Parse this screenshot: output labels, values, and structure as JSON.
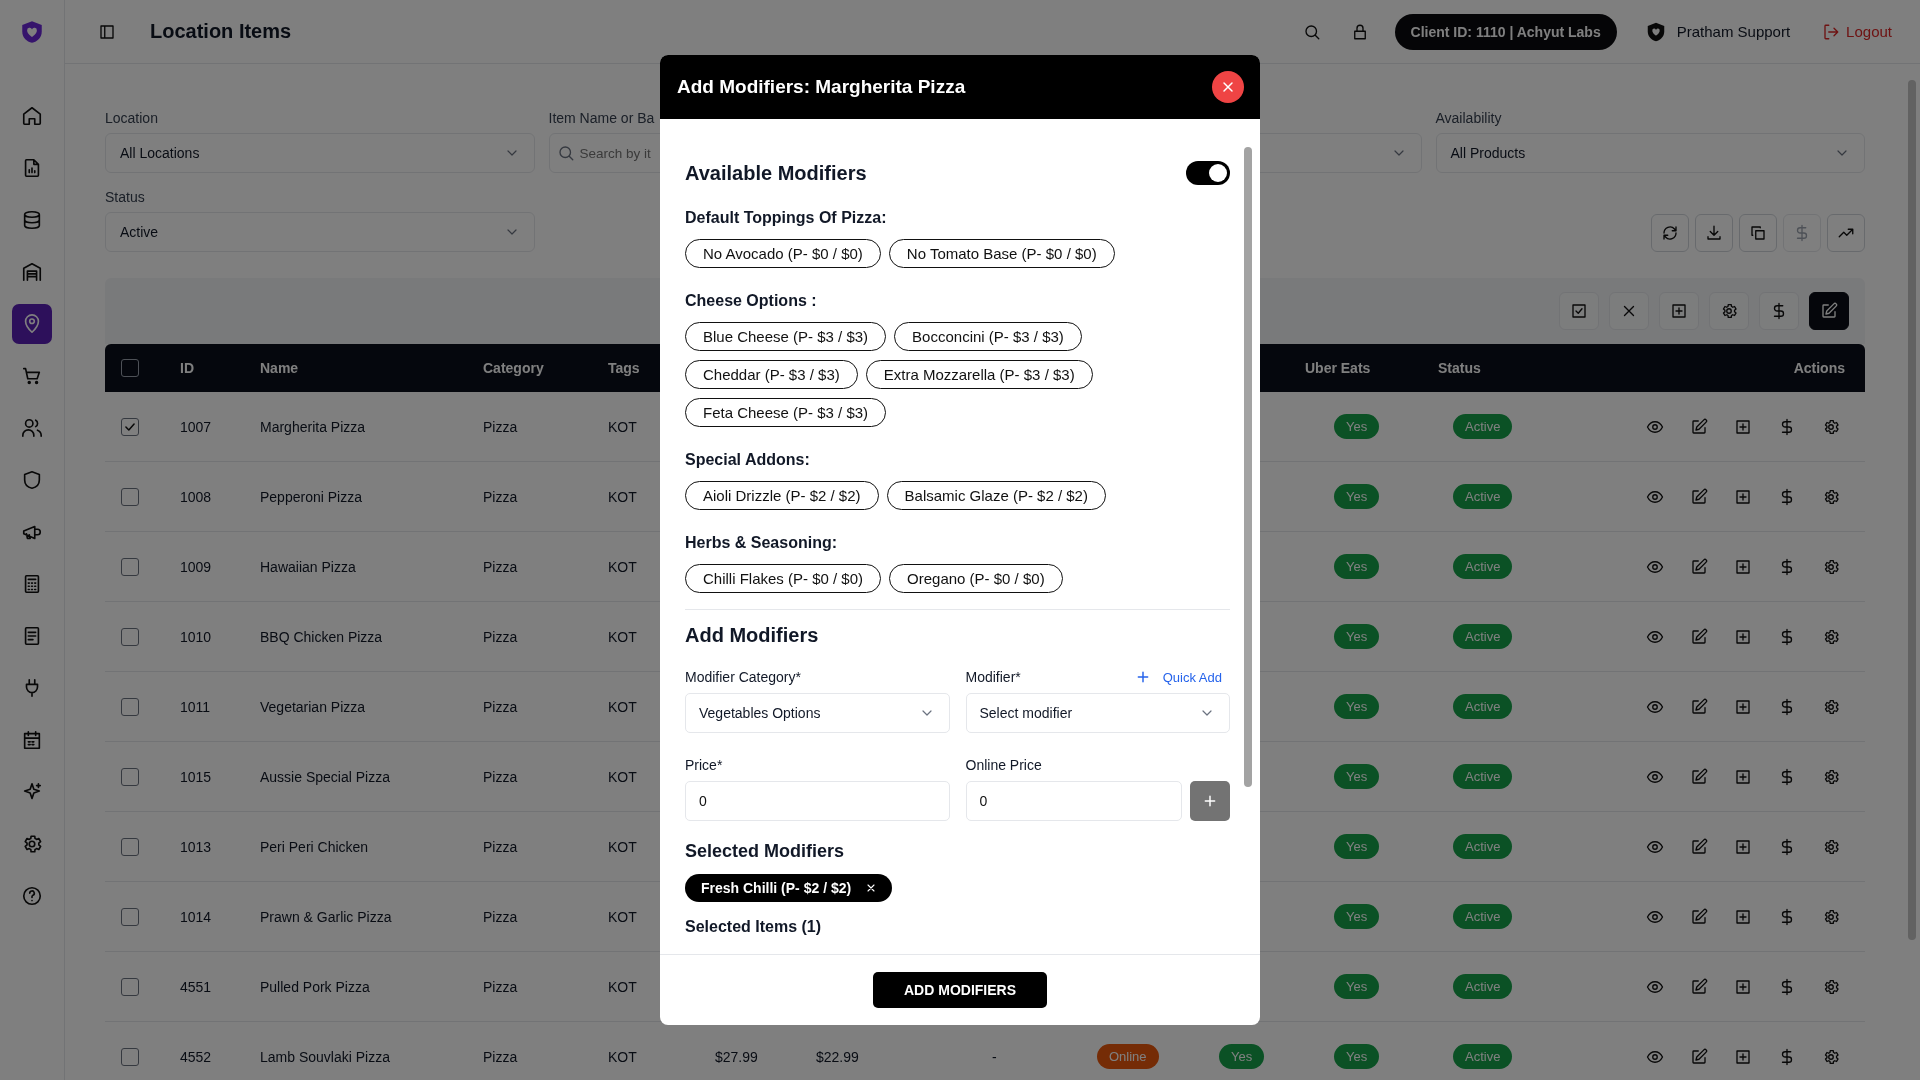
{
  "topbar": {
    "title": "Location Items",
    "client": "Client ID: 1110 | Achyut Labs",
    "user": "Pratham Support",
    "logout": "Logout"
  },
  "sidebar": {
    "items": [
      {
        "selected": false
      },
      {
        "selected": false
      },
      {
        "selected": false
      },
      {
        "selected": false
      },
      {
        "selected": true
      },
      {
        "selected": false
      },
      {
        "selected": false
      },
      {
        "selected": false
      },
      {
        "selected": false
      },
      {
        "selected": false
      },
      {
        "selected": false
      },
      {
        "selected": false
      },
      {
        "selected": false
      },
      {
        "selected": false
      },
      {
        "selected": false
      },
      {
        "selected": false
      }
    ]
  },
  "filters": [
    {
      "kind": "select",
      "label": "Location",
      "value": "All Locations"
    },
    {
      "kind": "search",
      "label": "Item Name or Ba",
      "placeholder": "Search by it"
    },
    {
      "kind": "select"
    },
    {
      "kind": "select",
      "label": "Availability",
      "value": "All Products"
    },
    {
      "kind": "select",
      "label": "Status",
      "value": "Active"
    }
  ],
  "toolbar": [
    {
      "disabled": false
    },
    {
      "disabled": false
    },
    {
      "disabled": false
    },
    {
      "disabled": true
    },
    {
      "disabled": false
    }
  ],
  "bulk_actions": [
    {
      "selected": false
    },
    {
      "selected": false
    },
    {
      "selected": false
    },
    {
      "selected": false
    },
    {
      "selected": false
    },
    {
      "selected": true
    }
  ],
  "table": {
    "columns": {
      "id": "ID",
      "name": "Name",
      "category": "Category",
      "tags": "Tags",
      "uber_eats": "Uber Eats",
      "status": "Status",
      "actions": "Actions"
    },
    "all_checked": false,
    "rows": [
      {
        "checked": true,
        "id": "1007",
        "name": "Margherita Pizza",
        "category": "Pizza",
        "tags": "KOT",
        "uber_eats": "Yes",
        "status": "Active"
      },
      {
        "checked": false,
        "id": "1008",
        "name": "Pepperoni Pizza",
        "category": "Pizza",
        "tags": "KOT",
        "uber_eats": "Yes",
        "status": "Active"
      },
      {
        "checked": false,
        "id": "1009",
        "name": "Hawaiian Pizza",
        "category": "Pizza",
        "tags": "KOT",
        "uber_eats": "Yes",
        "status": "Active"
      },
      {
        "checked": false,
        "id": "1010",
        "name": "BBQ Chicken Pizza",
        "category": "Pizza",
        "tags": "KOT",
        "uber_eats": "Yes",
        "status": "Active"
      },
      {
        "checked": false,
        "id": "1011",
        "name": "Vegetarian Pizza",
        "category": "Pizza",
        "tags": "KOT",
        "uber_eats": "Yes",
        "status": "Active"
      },
      {
        "checked": false,
        "id": "1015",
        "name": "Aussie Special Pizza",
        "category": "Pizza",
        "tags": "KOT",
        "uber_eats": "Yes",
        "status": "Active"
      },
      {
        "checked": false,
        "id": "1013",
        "name": "Peri Peri Chicken",
        "category": "Pizza",
        "tags": "KOT",
        "uber_eats": "Yes",
        "status": "Active"
      },
      {
        "checked": false,
        "id": "1014",
        "name": "Prawn & Garlic Pizza",
        "category": "Pizza",
        "tags": "KOT",
        "uber_eats": "Yes",
        "status": "Active"
      },
      {
        "checked": false,
        "id": "4551",
        "name": "Pulled Pork Pizza",
        "category": "Pizza",
        "tags": "KOT",
        "uber_eats": "Yes",
        "status": "Active"
      },
      {
        "checked": false,
        "id": "4552",
        "name": "Lamb Souvlaki Pizza",
        "category": "Pizza",
        "tags": "KOT",
        "column_6": "$27.99",
        "column_7": "$22.99",
        "column_8": "-",
        "column_9": "Online",
        "column_10": "Yes",
        "uber_eats": "Yes",
        "status": "Active"
      }
    ]
  },
  "modal": {
    "title": "Add Modifiers: Margherita Pizza",
    "available": {
      "heading": "Available Modifiers",
      "on": true,
      "groups": [
        {
          "title": "Default Toppings Of Pizza:",
          "modifiers": [
            "No Avocado (P- $0 / $0)",
            "No Tomato Base (P- $0 / $0)"
          ]
        },
        {
          "title": "Cheese Options :",
          "modifiers": [
            "Blue Cheese (P- $3 / $3)",
            "Bocconcini (P- $3 / $3)",
            "Cheddar (P- $3 / $3)",
            "Extra Mozzarella (P- $3 / $3)",
            "Feta Cheese (P- $3 / $3)"
          ]
        },
        {
          "title": "Special Addons:",
          "modifiers": [
            "Aioli Drizzle (P- $2 / $2)",
            "Balsamic Glaze (P- $2 / $2)"
          ]
        },
        {
          "title": "Herbs & Seasoning:",
          "modifiers": [
            "Chilli Flakes (P- $0 / $0)",
            "Oregano (P- $0 / $0)"
          ]
        }
      ]
    },
    "add": {
      "heading": "Add Modifiers",
      "category": {
        "label": "Modifier Category*",
        "value": "Vegetables Options"
      },
      "modifier": {
        "label": "Modifier*",
        "value": "Select modifier"
      },
      "quick_add": "Quick Add",
      "price": {
        "label": "Price*",
        "value": "0"
      },
      "online_price": {
        "label": "Online Price",
        "value": "0"
      }
    },
    "selected": {
      "heading": "Selected Modifiers",
      "modifiers": [
        "Fresh Chilli (P- $2 / $2)"
      ]
    },
    "selected_items_heading": "Selected Items (1)",
    "submit": "ADD MODIFIERS"
  }
}
